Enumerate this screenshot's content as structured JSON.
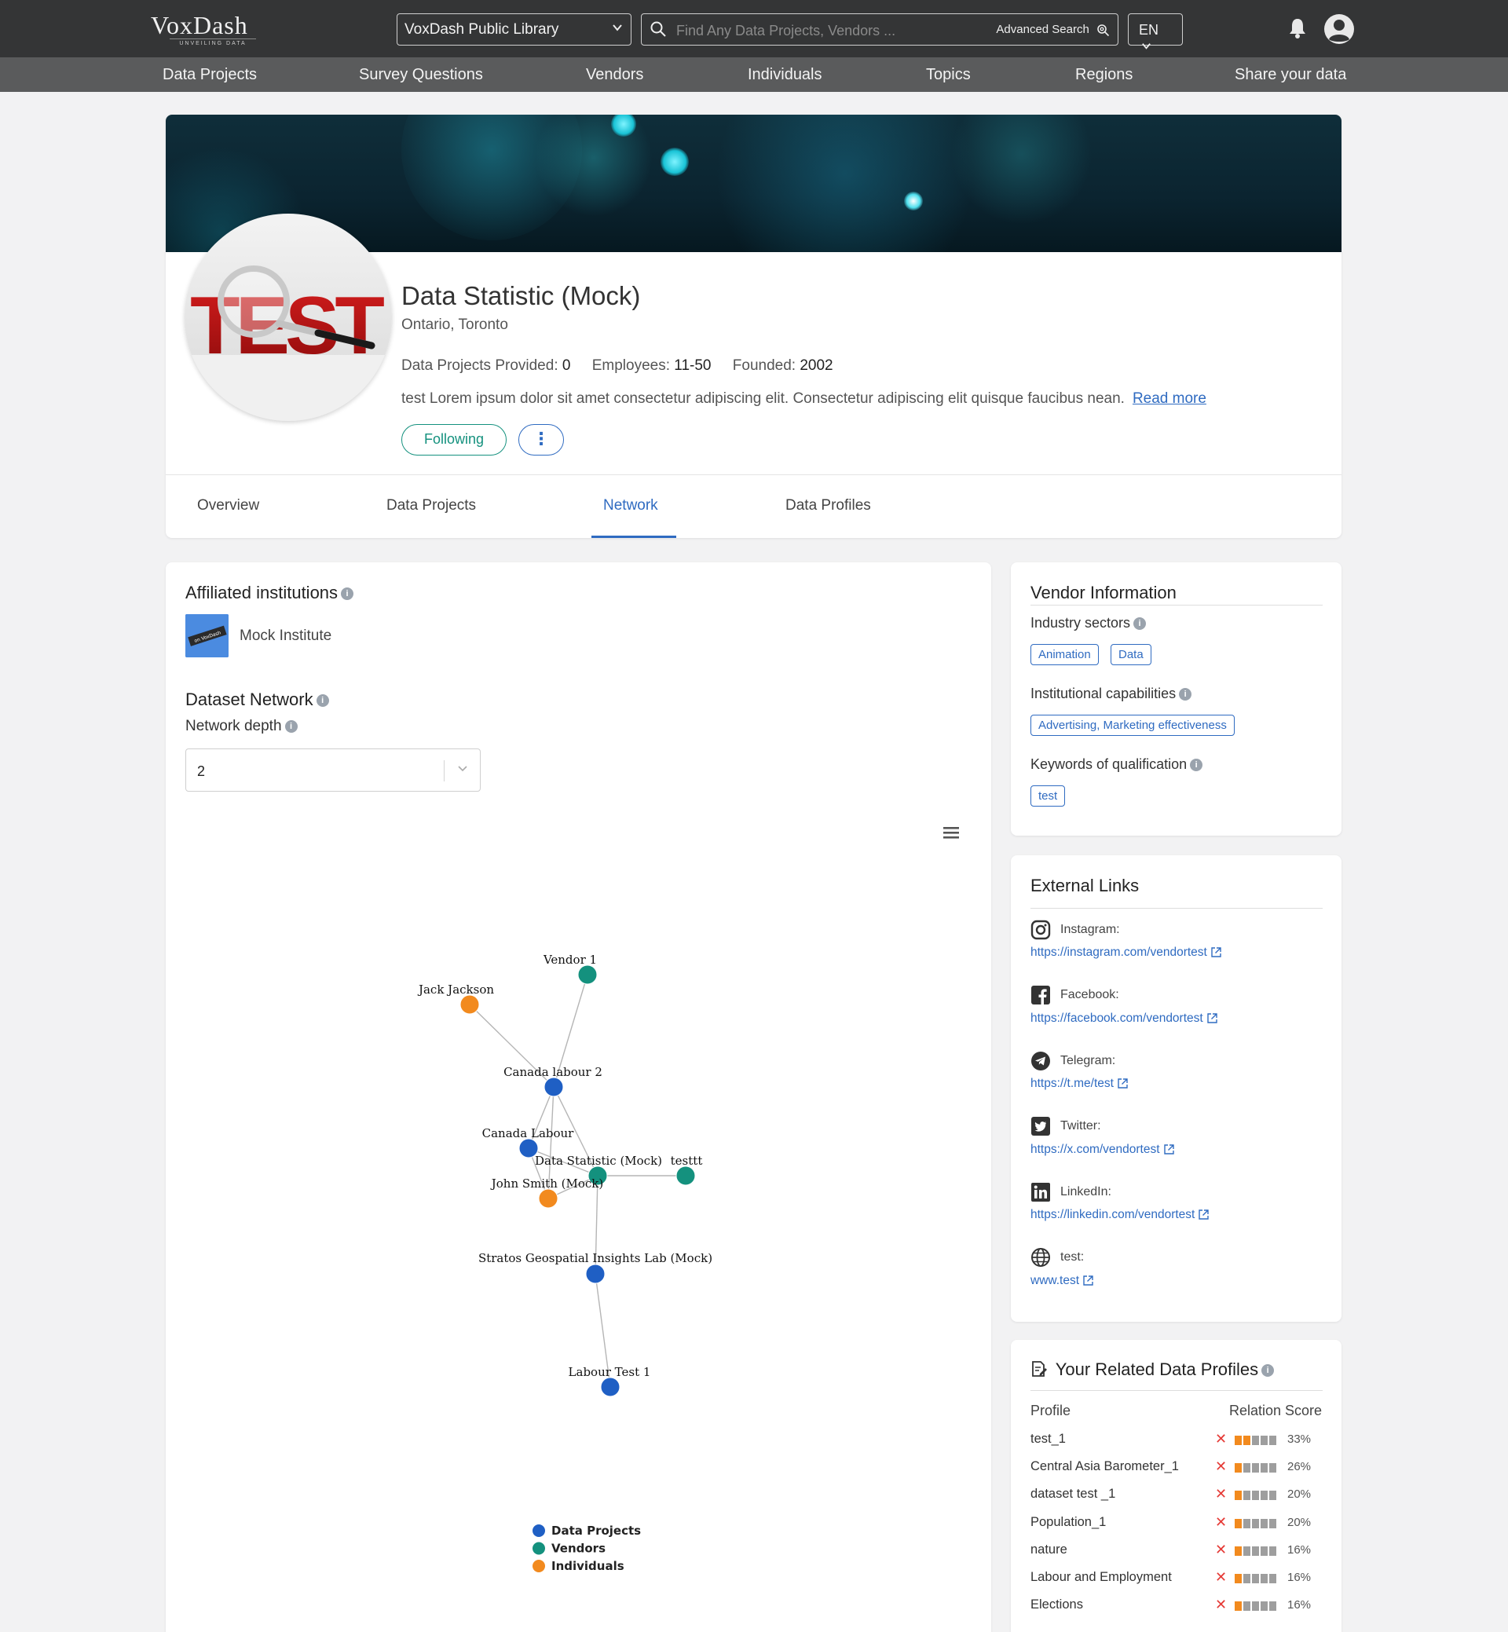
{
  "topbar": {
    "logo": "VoxDash",
    "logo_tagline": "UNVEILING DATA",
    "library_select": "VoxDash Public Library",
    "search_placeholder": "Find Any Data Projects, Vendors ...",
    "advanced_search": "Advanced Search",
    "language": "EN",
    "icons": [
      "search-icon",
      "gear-search-icon",
      "bell-icon",
      "user-icon"
    ]
  },
  "nav": [
    "Data Projects",
    "Survey Questions",
    "Vendors",
    "Individuals",
    "Topics",
    "Regions",
    "Share your data"
  ],
  "profile": {
    "name": "Data Statistic (Mock)",
    "location": "Ontario, Toronto",
    "avatar_text": "TEST",
    "stats": {
      "projects_label": "Data Projects Provided:",
      "projects_value": "0",
      "employees_label": "Employees:",
      "employees_value": "11-50",
      "founded_label": "Founded:",
      "founded_value": "2002"
    },
    "description": "test Lorem ipsum dolor sit amet consectetur adipiscing elit. Consectetur adipiscing elit quisque faucibus nean.",
    "read_more": "Read more",
    "follow_button": "Following",
    "more_button": "⋮"
  },
  "tabs": {
    "items": [
      "Overview",
      "Data Projects",
      "Network",
      "Data Profiles"
    ],
    "active": "Network"
  },
  "network_section": {
    "affiliated_title": "Affiliated institutions",
    "institution_name": "Mock Institute",
    "institution_logo_text": "on VoxDash",
    "dataset_network_title": "Dataset Network",
    "depth_label": "Network depth",
    "depth_value": "2",
    "menu_icon": "hamburger-icon"
  },
  "chart_data": {
    "type": "network",
    "nodes": [
      {
        "label": "Vendor 1",
        "group": "Vendors"
      },
      {
        "label": "Jack Jackson",
        "group": "Individuals"
      },
      {
        "label": "Canada labour 2",
        "group": "Data Projects"
      },
      {
        "label": "Canada Labour",
        "group": "Data Projects"
      },
      {
        "label": "Data Statistic (Mock)",
        "group": "Vendors"
      },
      {
        "label": "testtt",
        "group": "Vendors"
      },
      {
        "label": "John Smith (Mock)",
        "group": "Individuals"
      },
      {
        "label": "Stratos Geospatial Insights Lab (Mock)",
        "group": "Data Projects"
      },
      {
        "label": "Labour Test 1",
        "group": "Data Projects"
      }
    ],
    "edges": [
      [
        "Vendor 1",
        "Canada labour 2"
      ],
      [
        "Jack Jackson",
        "Canada labour 2"
      ],
      [
        "Canada labour 2",
        "Canada Labour"
      ],
      [
        "Canada labour 2",
        "Data Statistic (Mock)"
      ],
      [
        "Canada labour 2",
        "John Smith (Mock)"
      ],
      [
        "Canada Labour",
        "Data Statistic (Mock)"
      ],
      [
        "Canada Labour",
        "John Smith (Mock)"
      ],
      [
        "Data Statistic (Mock)",
        "testtt"
      ],
      [
        "Data Statistic (Mock)",
        "John Smith (Mock)"
      ],
      [
        "Data Statistic (Mock)",
        "Stratos Geospatial Insights Lab (Mock)"
      ],
      [
        "Stratos Geospatial Insights Lab (Mock)",
        "Labour Test 1"
      ]
    ],
    "legend": [
      {
        "name": "Data Projects",
        "color": "#1f5fc4"
      },
      {
        "name": "Vendors",
        "color": "#14917e"
      },
      {
        "name": "Individuals",
        "color": "#f28a1e"
      }
    ]
  },
  "vendor_info": {
    "title": "Vendor Information",
    "industry_label": "Industry sectors",
    "industry": [
      "Animation",
      "Data"
    ],
    "capabilities_label": "Institutional capabilities",
    "capabilities": [
      "Advertising, Marketing effectiveness"
    ],
    "keywords_label": "Keywords of qualification",
    "keywords": [
      "test"
    ]
  },
  "external_links": {
    "title": "External Links",
    "links": [
      {
        "label": "Instagram:",
        "url": "https://instagram.com/vendortest",
        "icon": "instagram-icon"
      },
      {
        "label": "Facebook:",
        "url": "https://facebook.com/vendortest",
        "icon": "facebook-icon"
      },
      {
        "label": "Telegram:",
        "url": "https://t.me/test",
        "icon": "telegram-icon"
      },
      {
        "label": "Twitter:",
        "url": "https://x.com/vendortest",
        "icon": "twitter-icon"
      },
      {
        "label": "LinkedIn:",
        "url": "https://linkedin.com/vendortest",
        "icon": "linkedin-icon"
      },
      {
        "label": "test:",
        "url": "www.test",
        "icon": "globe-icon"
      }
    ]
  },
  "related_profiles": {
    "title": "Your Related Data Profiles",
    "col_profile": "Profile",
    "col_score": "Relation Score",
    "rows": [
      {
        "name": "test_1",
        "score": "33%",
        "level": 2
      },
      {
        "name": "Central Asia Barometer_1",
        "score": "26%",
        "level": 1
      },
      {
        "name": "dataset test _1",
        "score": "20%",
        "level": 1
      },
      {
        "name": "Population_1",
        "score": "20%",
        "level": 1
      },
      {
        "name": "nature",
        "score": "16%",
        "level": 1
      },
      {
        "name": "Labour and Employment",
        "score": "16%",
        "level": 1
      },
      {
        "name": "Elections",
        "score": "16%",
        "level": 1
      }
    ]
  },
  "colors": {
    "topbar": "#343536",
    "navbar": "#5a5b5c",
    "accent_blue": "#2f6bc1",
    "accent_teal": "#14917e",
    "orange": "#f28a1e",
    "remove_red": "#e53935"
  }
}
